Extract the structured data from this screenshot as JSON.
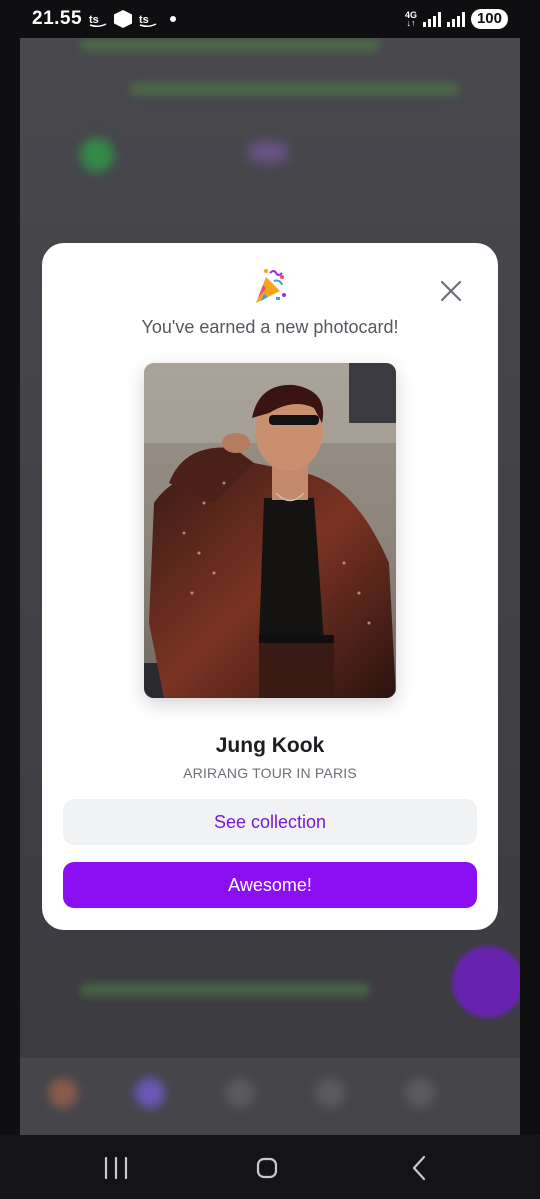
{
  "status_bar": {
    "time": "21.55",
    "app_icons": [
      "ts-notification-icon",
      "hexagon-app-icon",
      "ts-notification-icon"
    ],
    "network": "4G",
    "battery": "100"
  },
  "modal": {
    "celebration_icon": "party-popper-icon",
    "heading": "You've earned a new photocard!",
    "card": {
      "name": "Jung Kook",
      "tour": "ARIRANG TOUR IN PARIS",
      "image_alt": "photocard-image"
    },
    "secondary_button": "See collection",
    "primary_button": "Awesome!",
    "close_icon": "close-icon"
  },
  "colors": {
    "primary": "#8c0ff4",
    "secondary_bg": "#f1f2f4",
    "secondary_text": "#7b18cf"
  },
  "nav_bar": {
    "icons": [
      "recent-apps-icon",
      "home-icon",
      "back-icon"
    ]
  }
}
